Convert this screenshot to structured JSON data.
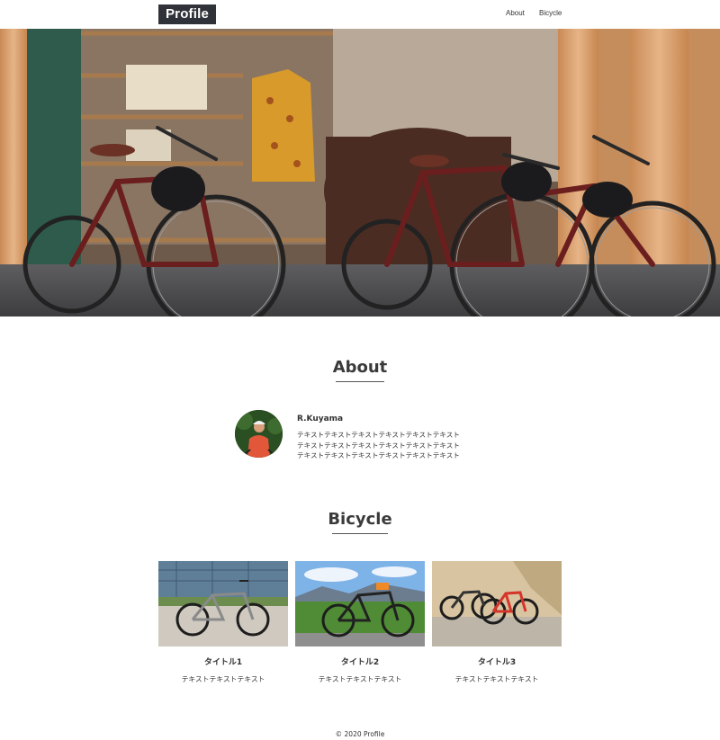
{
  "header": {
    "logo": "Profile",
    "nav": [
      {
        "label": "About"
      },
      {
        "label": "Bicycle"
      }
    ]
  },
  "about": {
    "title": "About",
    "name": "R.Kuyama",
    "text_lines": [
      "テキストテキストテキストテキストテキストテキスト",
      "テキストテキストテキストテキストテキストテキスト",
      "テキストテキストテキストテキストテキストテキスト"
    ]
  },
  "bicycle": {
    "title": "Bicycle",
    "cards": [
      {
        "title": "タイトル1",
        "text": "テキストテキストテキスト"
      },
      {
        "title": "タイトル2",
        "text": "テキストテキストテキスト"
      },
      {
        "title": "タイトル3",
        "text": "テキストテキストテキスト"
      }
    ]
  },
  "footer": {
    "copyright": "© 2020 Profile"
  },
  "colors": {
    "logo_bg": "#2f3238",
    "text": "#333333",
    "bike_frame": "#6b1e1e",
    "wood": "#d9a272"
  }
}
